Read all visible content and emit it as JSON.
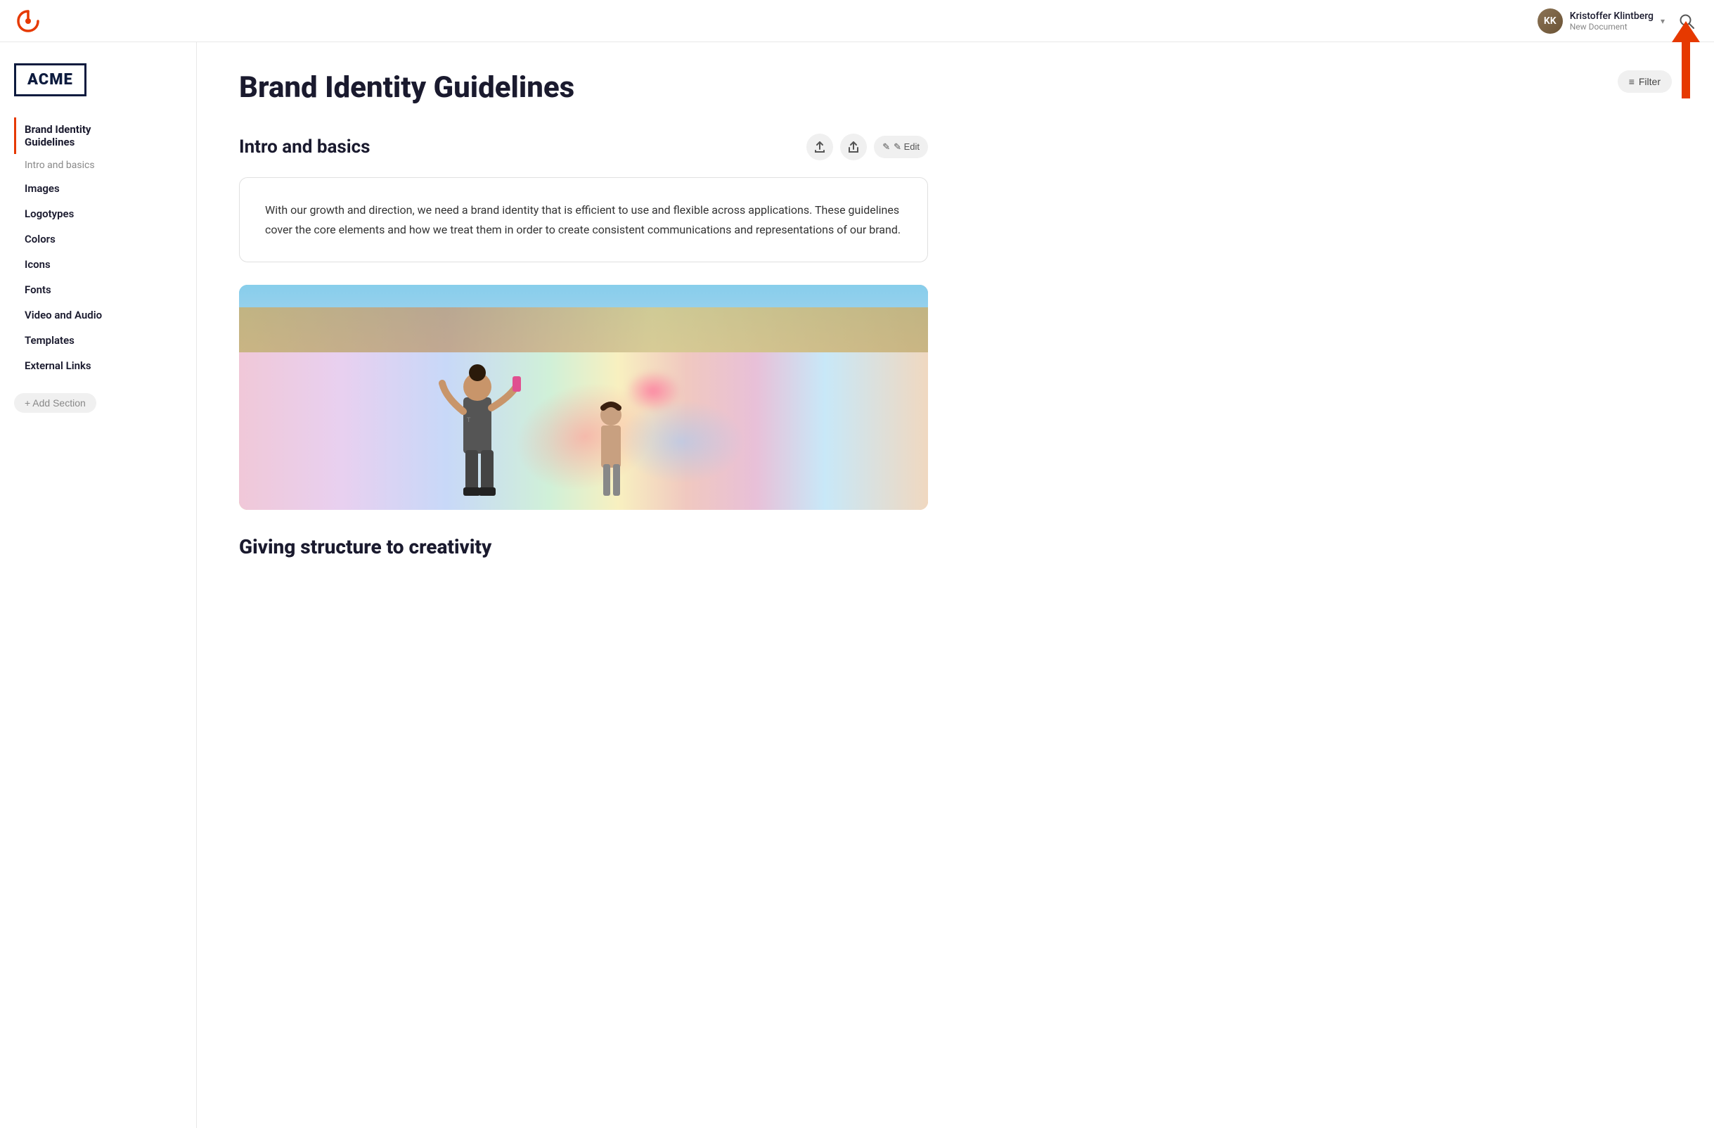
{
  "header": {
    "logo_alt": "Frontify logo",
    "user_name": "Kristoffer Klintberg",
    "user_doc": "New Document",
    "dropdown_label": "▾",
    "search_label": "🔍"
  },
  "filter_button": {
    "label": "Filter",
    "icon": "≡"
  },
  "sidebar": {
    "logo_text": "ACME",
    "active_item": {
      "label": "Brand Identity\nGuidelines"
    },
    "sub_item": "Intro and basics",
    "items": [
      {
        "label": "Images"
      },
      {
        "label": "Logotypes"
      },
      {
        "label": "Colors"
      },
      {
        "label": "Icons"
      },
      {
        "label": "Fonts"
      },
      {
        "label": "Video and Audio"
      },
      {
        "label": "Templates"
      },
      {
        "label": "External Links"
      }
    ],
    "add_section": "+ Add Section"
  },
  "main": {
    "page_title": "Brand Identity Guidelines",
    "section_title": "Intro and basics",
    "description": "With our growth and direction, we need a brand identity that is efficient to use and flexible across applications. These guidelines cover the core elements and how we treat them in order to create consistent communications and representations of our brand.",
    "section_subtitle": "Giving structure to creativity",
    "actions": {
      "upload_icon": "⬆",
      "share_icon": "⬆",
      "edit_label": "✎ Edit"
    }
  }
}
